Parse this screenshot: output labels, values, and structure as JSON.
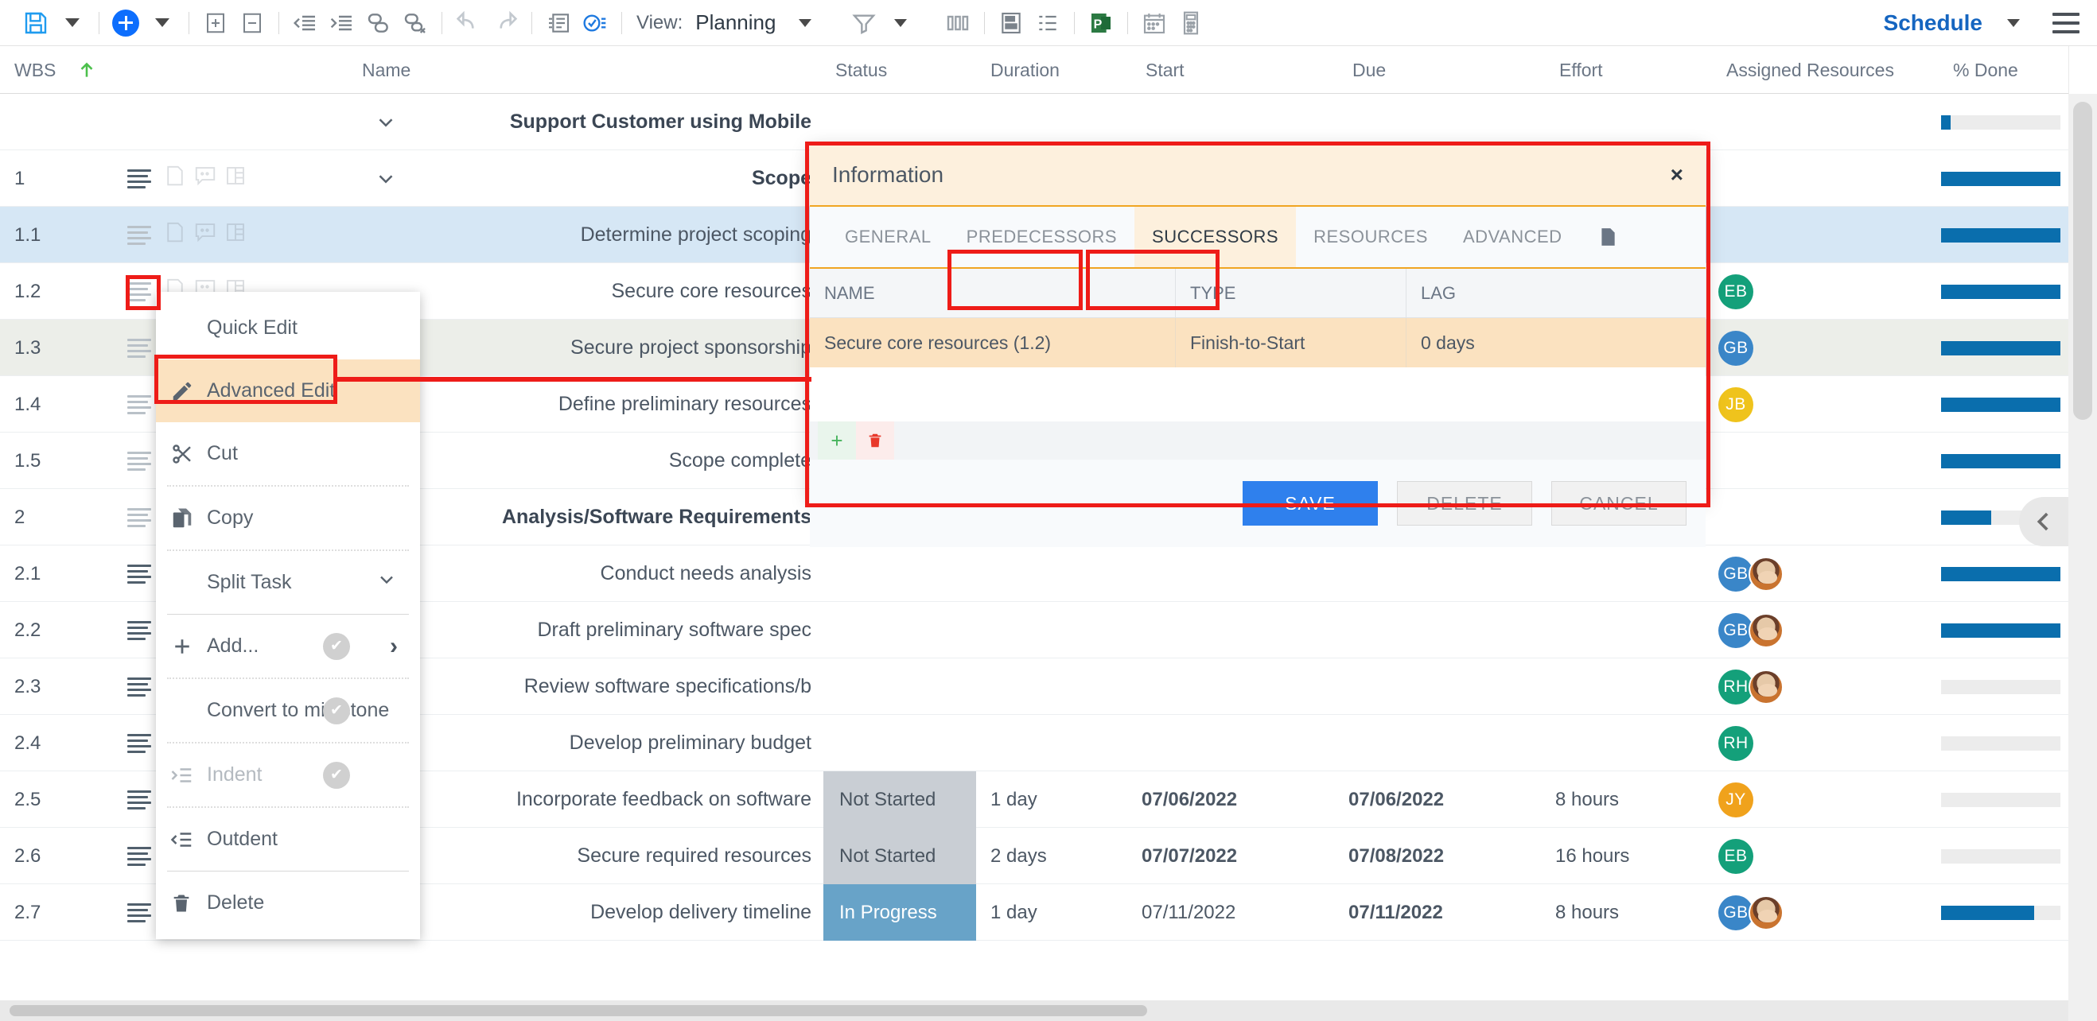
{
  "toolbar": {
    "save_label": "save-icon",
    "save_caret": "dropdown-caret",
    "add_label": "add-task",
    "add_caret": "dropdown-caret",
    "expand_all": "expand-all",
    "collapse_all": "collapse-all",
    "outdent": "outdent",
    "indent": "indent",
    "link": "link-tasks",
    "unlink": "unlink-tasks",
    "undo": "undo",
    "redo": "redo",
    "notes": "notes",
    "check": "task-check",
    "view_label": "View:",
    "view_value": "Planning",
    "view_caret": "dropdown-caret",
    "filter": "filter",
    "filter_caret": "dropdown-caret",
    "columns": "columns",
    "baseline": "baseline",
    "outline": "outline",
    "msproject": "ms-project-export",
    "calendar": "calendar",
    "calculator": "calculator",
    "schedule_label": "Schedule",
    "schedule_caret": "dropdown-caret",
    "menu": "main-menu"
  },
  "columns": [
    {
      "label": "WBS"
    },
    {
      "label": "Name"
    },
    {
      "label": "Status"
    },
    {
      "label": "Duration"
    },
    {
      "label": "Start"
    },
    {
      "label": "Due"
    },
    {
      "label": "Effort"
    },
    {
      "label": "Assigned Resources"
    },
    {
      "label": "% Done"
    }
  ],
  "sort_indicator": "sort-ascending-arrow",
  "rows": [
    {
      "wbs": "",
      "name": "Support Customer using Mobile",
      "bold": true,
      "chevron": "chevron-down",
      "status": "",
      "duration": "",
      "start": "",
      "due": "",
      "effort": "",
      "avatars": [],
      "progress": 8,
      "style": "plain",
      "badges": false
    },
    {
      "wbs": "1",
      "name": "Scope",
      "bold": true,
      "chevron": "chevron-down",
      "status": "",
      "duration": "",
      "start": "",
      "due": "",
      "effort": "",
      "avatars": [],
      "progress": 100,
      "style": "plain",
      "badges": true
    },
    {
      "wbs": "1.1",
      "name": "Determine project scoping",
      "bold": false,
      "chevron": "",
      "status": "",
      "duration": "",
      "start": "",
      "due": "",
      "effort": "",
      "avatars": [],
      "progress": 100,
      "style": "sel",
      "badges": true
    },
    {
      "wbs": "1.2",
      "name": "Secure core resources",
      "bold": false,
      "chevron": "",
      "status": "",
      "duration": "",
      "start": "",
      "due": "",
      "effort": "",
      "avatars": [
        {
          "initials": "EB",
          "color": "#14a07a"
        }
      ],
      "progress": 100,
      "style": "plain",
      "badges": true
    },
    {
      "wbs": "1.3",
      "name": "Secure project sponsorship",
      "bold": false,
      "chevron": "",
      "status": "",
      "duration": "",
      "start": "",
      "due": "",
      "effort": "",
      "avatars": [
        {
          "initials": "GB",
          "color": "#3a86c8"
        }
      ],
      "progress": 100,
      "style": "alt",
      "badges": true
    },
    {
      "wbs": "1.4",
      "name": "Define preliminary resources",
      "bold": false,
      "chevron": "",
      "status": "",
      "duration": "",
      "start": "",
      "due": "",
      "effort": "",
      "avatars": [
        {
          "initials": "JB",
          "color": "#efc31c"
        }
      ],
      "progress": 100,
      "style": "plain",
      "badges": true
    },
    {
      "wbs": "1.5",
      "name": "Scope complete",
      "bold": false,
      "chevron": "",
      "status": "",
      "duration": "",
      "start": "",
      "due": "",
      "effort": "",
      "avatars": [],
      "progress": 100,
      "style": "plain",
      "badges": true
    },
    {
      "wbs": "2",
      "name": "Analysis/Software Requirements",
      "bold": true,
      "chevron": "chevron-down",
      "status": "",
      "duration": "",
      "start": "",
      "due": "",
      "effort": "",
      "avatars": [],
      "progress": 42,
      "style": "plain",
      "badges": true
    },
    {
      "wbs": "2.1",
      "name": "Conduct needs analysis",
      "bold": false,
      "chevron": "",
      "status": "",
      "duration": "",
      "start": "",
      "due": "",
      "effort": "",
      "avatars": [
        {
          "initials": "GB",
          "color": "#3a86c8",
          "photo": true
        }
      ],
      "progress": 100,
      "style": "plain",
      "badges": true
    },
    {
      "wbs": "2.2",
      "name": "Draft preliminary software spec",
      "bold": false,
      "chevron": "",
      "status": "",
      "duration": "",
      "start": "",
      "due": "",
      "effort": "",
      "avatars": [
        {
          "initials": "GB",
          "color": "#3a86c8",
          "photo": true
        }
      ],
      "progress": 100,
      "style": "plain",
      "badges": true
    },
    {
      "wbs": "2.3",
      "name": "Review software specifications/b",
      "bold": false,
      "chevron": "",
      "status": "",
      "duration": "",
      "start": "",
      "due": "",
      "effort": "",
      "avatars": [
        {
          "initials": "RH",
          "color": "#14a07a",
          "photo": true
        }
      ],
      "progress": 0,
      "style": "plain",
      "badges": true
    },
    {
      "wbs": "2.4",
      "name": "Develop preliminary budget",
      "bold": false,
      "chevron": "",
      "status": "",
      "duration": "",
      "start": "",
      "due": "",
      "effort": "",
      "avatars": [
        {
          "initials": "RH",
          "color": "#14a07a"
        }
      ],
      "progress": 0,
      "style": "plain",
      "badges": true
    },
    {
      "wbs": "2.5",
      "name": "Incorporate feedback on software",
      "bold": false,
      "chevron": "",
      "status": "Not Started",
      "duration": "1 day",
      "start": "07/06/2022",
      "due": "07/06/2022",
      "effort": "8 hours",
      "start_late": true,
      "due_late": true,
      "avatars": [
        {
          "initials": "JY",
          "color": "#f0a21c"
        }
      ],
      "progress": 0,
      "style": "plain",
      "badges": true
    },
    {
      "wbs": "2.6",
      "name": "Secure required resources",
      "bold": false,
      "chevron": "",
      "status": "Not Started",
      "duration": "2 days",
      "start": "07/07/2022",
      "due": "07/08/2022",
      "effort": "16 hours",
      "start_late": true,
      "due_late": true,
      "avatars": [
        {
          "initials": "EB",
          "color": "#14a07a"
        }
      ],
      "progress": 0,
      "style": "plain",
      "badges": true
    },
    {
      "wbs": "2.7",
      "name": "Develop delivery timeline",
      "bold": false,
      "chevron": "",
      "status": "In Progress",
      "duration": "1 day",
      "start": "07/11/2022",
      "due": "07/11/2022",
      "effort": "8 hours",
      "start_late": false,
      "due_late": true,
      "avatars": [
        {
          "initials": "GB",
          "color": "#3a86c8",
          "photo": true
        }
      ],
      "progress": 78,
      "style": "plain",
      "badges": true,
      "completed_badge": true
    }
  ],
  "context_menu": {
    "items": [
      {
        "label": "Quick Edit",
        "icon": "",
        "state": "normal",
        "separator_after": "none"
      },
      {
        "label": "Advanced Edit",
        "icon": "pencil-icon",
        "state": "highlight",
        "separator_after": "none"
      },
      {
        "label": "Cut",
        "icon": "scissors-icon",
        "state": "normal",
        "separator_after": "dotted"
      },
      {
        "label": "Copy",
        "icon": "copy-icon",
        "state": "normal",
        "separator_after": "dotted"
      },
      {
        "label": "Split Task",
        "icon": "",
        "state": "normal",
        "separator_after": "solid",
        "chevron": "chevron-down"
      },
      {
        "label": "Add...",
        "icon": "plus-icon",
        "state": "normal",
        "separator_after": "dotted",
        "check": true,
        "arrow": "chevron-right-icon"
      },
      {
        "label": "Convert to milestone",
        "icon": "",
        "state": "normal",
        "separator_after": "dotted",
        "check": true
      },
      {
        "label": "Indent",
        "icon": "indent-icon",
        "state": "dim",
        "separator_after": "dotted",
        "check": true
      },
      {
        "label": "Outdent",
        "icon": "outdent-icon",
        "state": "normal",
        "separator_after": "solid"
      },
      {
        "label": "Delete",
        "icon": "trash-icon",
        "state": "normal",
        "separator_after": "none"
      }
    ]
  },
  "dialog": {
    "title": "Information",
    "close": "×",
    "tabs": [
      {
        "label": "GENERAL",
        "active": false
      },
      {
        "label": "PREDECESSORS",
        "active": false
      },
      {
        "label": "SUCCESSORS",
        "active": true
      },
      {
        "label": "RESOURCES",
        "active": false
      },
      {
        "label": "ADVANCED",
        "active": false
      }
    ],
    "notes_tab_icon": "note-icon",
    "table": {
      "headers": [
        "NAME",
        "TYPE",
        "LAG"
      ],
      "rows": [
        {
          "name": "Secure core resources (1.2)",
          "type": "Finish-to-Start",
          "lag": "0 days"
        }
      ]
    },
    "action_add": "+",
    "action_delete": "trash-icon",
    "buttons": {
      "save": "SAVE",
      "delete": "DELETE",
      "cancel": "CANCEL"
    }
  },
  "colors": {
    "accent_blue": "#2f80ed",
    "highlight_orange": "#fbe2c0",
    "dialog_border_red": "#ee1c18",
    "progress_blue": "#0a6ead",
    "selected_row": "#d6e7f5",
    "status_not_started": "#c9ced4",
    "status_in_progress": "#68a3c8",
    "overdue_date": "#e8232a"
  }
}
